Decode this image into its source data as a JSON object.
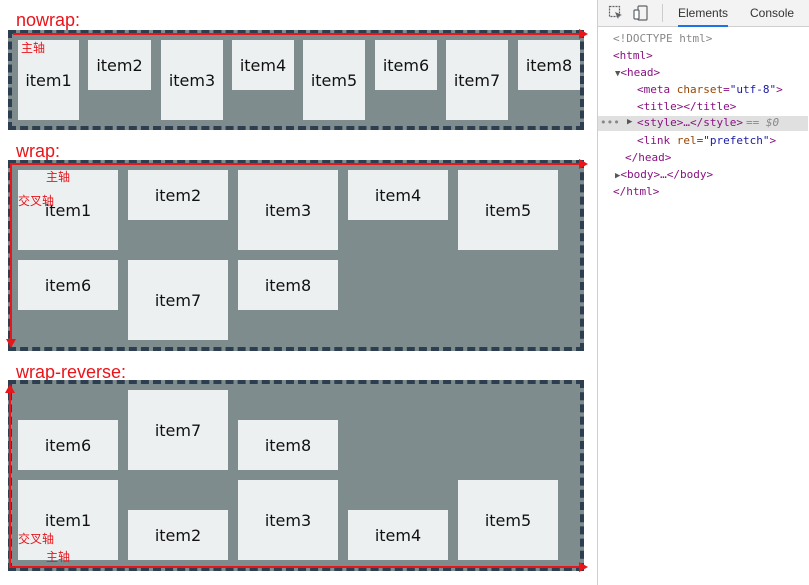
{
  "sections": [
    {
      "title": "nowrap:",
      "items": [
        "item1",
        "item2",
        "item3",
        "item4",
        "item5",
        "item6",
        "item7",
        "item8"
      ],
      "annotations": {
        "main_axis": "主轴"
      }
    },
    {
      "title": "wrap:",
      "items": [
        "item1",
        "item2",
        "item3",
        "item4",
        "item5",
        "item6",
        "item7",
        "item8"
      ],
      "annotations": {
        "main_axis": "主轴",
        "cross_axis": "交叉轴"
      }
    },
    {
      "title": "wrap-reverse:",
      "items": [
        "item1",
        "item2",
        "item3",
        "item4",
        "item5",
        "item6",
        "item7",
        "item8"
      ],
      "annotations": {
        "main_axis": "主轴",
        "cross_axis": "交叉轴"
      }
    }
  ],
  "colors": {
    "container_bg": "#7f8c8d",
    "container_border": "#2c3e50",
    "item_bg": "#ecf0f1",
    "annotation": "#e8151b"
  },
  "devtools": {
    "tabs": [
      "Elements",
      "Console"
    ],
    "active_tab": "Elements",
    "dom": {
      "doctype": "<!DOCTYPE html>",
      "html_open": "<html>",
      "head_open": "<head>",
      "meta_tag": "meta",
      "meta_attr": "charset",
      "meta_val": "\"utf-8\"",
      "title_text": "<title></title>",
      "style_text": "<style>…</style>",
      "style_suffix": "== $0",
      "link_tag": "link",
      "link_attr": "rel",
      "link_val": "\"prefetch\"",
      "head_close": "</head>",
      "body_text": "<body>…</body>",
      "html_close": "</html>",
      "dots": "•••"
    }
  }
}
